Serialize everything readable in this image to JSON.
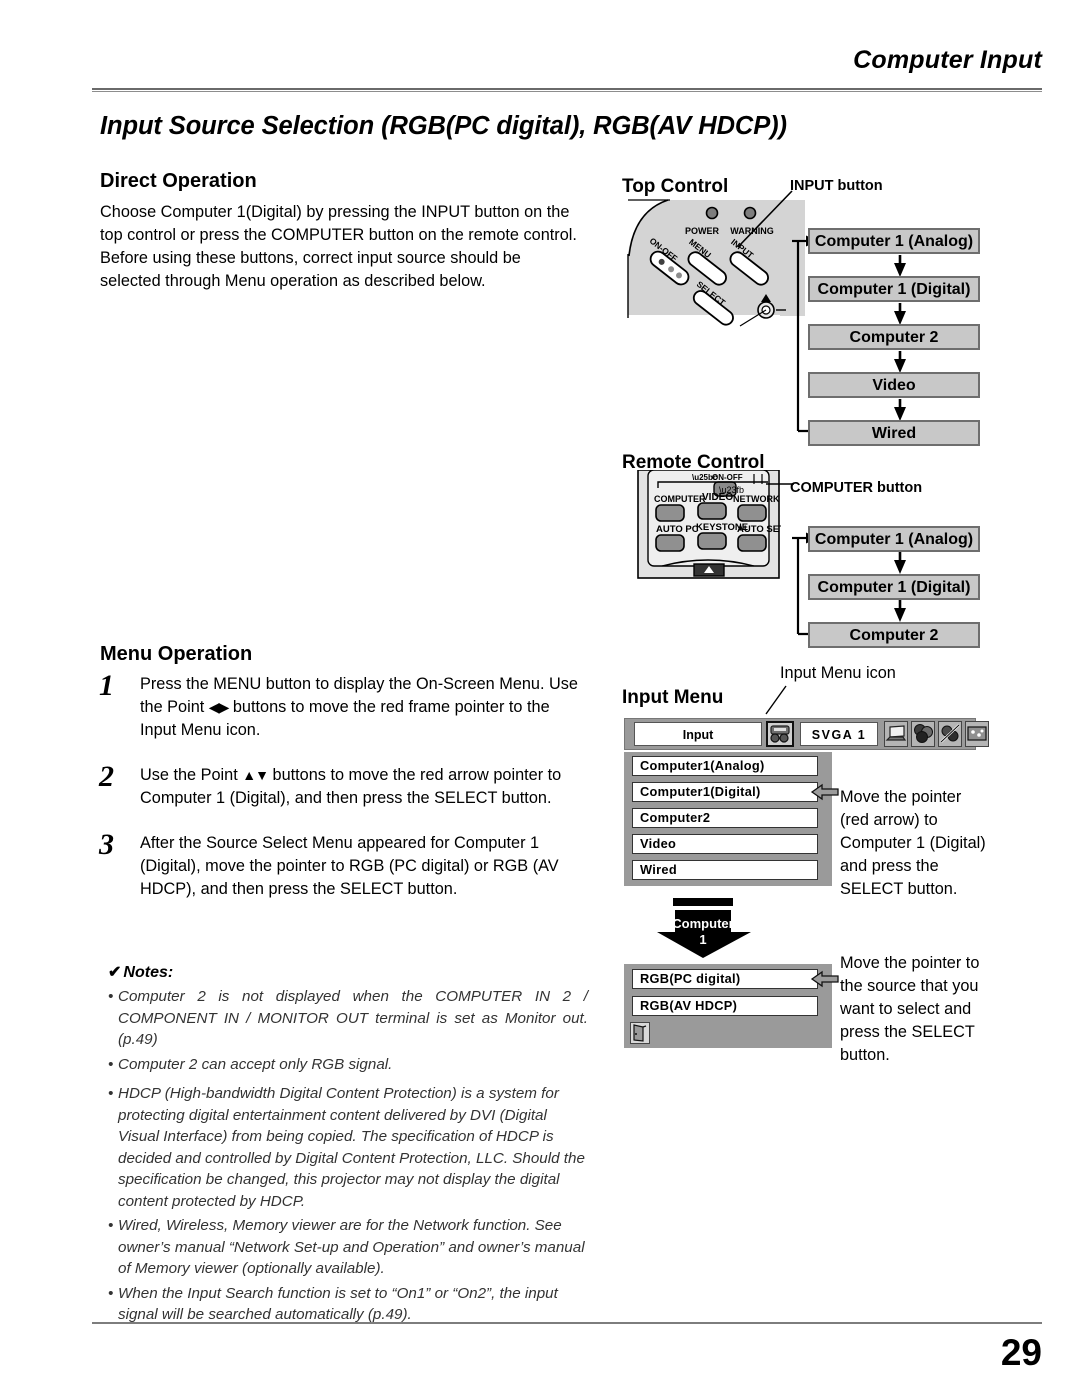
{
  "header": {
    "chapter": "Computer Input",
    "page_number": "29"
  },
  "doc_title": "Input Source Selection (RGB(PC digital), RGB(AV HDCP))",
  "direct_operation": {
    "heading": "Direct Operation",
    "paragraph1": "Choose Computer 1(Digital) by pressing the INPUT button on the top control or press the COMPUTER button on the remote control.",
    "paragraph2": "Before using these buttons, correct input source should be selected through Menu operation as described below."
  },
  "menu_operation": {
    "heading": "Menu Operation",
    "steps": [
      {
        "num": "1",
        "text_a": "Press the MENU button to display the On-Screen Menu. Use the Point ",
        "arrows": "◀▶",
        "text_b": " buttons to move the red frame pointer to the Input Menu icon."
      },
      {
        "num": "2",
        "text_a": "Use the Point ",
        "arrows": "▲▼",
        "text_b": " buttons to move the red arrow pointer to Computer 1 (Digital), and then press the SELECT button."
      },
      {
        "num": "3",
        "text_a": "After the Source Select Menu appeared for Computer 1 (Digital), move the pointer to RGB (PC digital) or RGB (AV HDCP), and then press the SELECT button.",
        "arrows": "",
        "text_b": ""
      }
    ]
  },
  "notes": {
    "title": "Notes:",
    "check_glyph": "✔",
    "bullet": "•",
    "items": [
      "Computer 2 is not displayed when the COMPUTER IN 2 / COMPONENT IN / MONITOR OUT terminal is set as Monitor out. (p.49)",
      "Computer 2 can accept only RGB signal.",
      "HDCP (High-bandwidth Digital Content Protection) is a system for protecting digital entertainment content delivered by DVI (Digital Visual Interface) from being copied.  The specification of HDCP is decided and controlled by Digital Content Protection, LLC. Should the specification be changed, this projector may not display the digital content protected by HDCP.",
      "Wired, Wireless, Memory viewer are for the Network  function. See owner’s manual “Network Set-up and Operation” and owner’s manual of Memory viewer (optionally available).",
      "When the Input Search function is set to “On1” or “On2”, the input signal will be searched automatically (p.49)."
    ]
  },
  "top_control": {
    "heading": "Top Control",
    "callout": "INPUT button",
    "led_labels": [
      "POWER",
      "WARNING"
    ],
    "button_labels": [
      "ON-OFF",
      "MENU",
      "INPUT",
      "SELECT"
    ],
    "flow": [
      "Computer 1 (Analog)",
      "Computer 1 (Digital)",
      "Computer 2",
      "Video",
      "Wired"
    ]
  },
  "remote_control": {
    "heading": "Remote Control",
    "callout": "COMPUTER button",
    "top_label": "ON-OFF",
    "buttons": [
      "COMPUTER",
      "VIDEO",
      "NETWORK",
      "AUTO PC",
      "KEYSTONE",
      "AUTO SET"
    ],
    "flow": [
      "Computer 1 (Analog)",
      "Computer 1 (Digital)",
      "Computer 2"
    ]
  },
  "input_menu": {
    "heading": "Input Menu",
    "icon_callout": "Input Menu icon",
    "menu_bar": {
      "title_field": "Input",
      "selected_icon": "input-menu-icon",
      "mode_field": "SVGA 1",
      "icons": [
        "laptop-icon",
        "color-adjust-icon",
        "sound-image-icon",
        "screen-icon"
      ]
    },
    "items": [
      "Computer1(Analog)",
      "Computer1(Digital)",
      "Computer2",
      "Video",
      "Wired"
    ],
    "selected_item_index": 1,
    "instruction": "Move the pointer (red arrow) to Computer 1 (Digital) and press the SELECT button."
  },
  "source_select": {
    "arrow_label_line1": "Computer",
    "arrow_label_line2": "1",
    "items": [
      "RGB(PC digital)",
      "RGB(AV HDCP)"
    ],
    "selected_item_index": 0,
    "exit_icon": "exit-door-icon",
    "instruction": "Move the pointer to the source that you want to select and press the SELECT button."
  }
}
